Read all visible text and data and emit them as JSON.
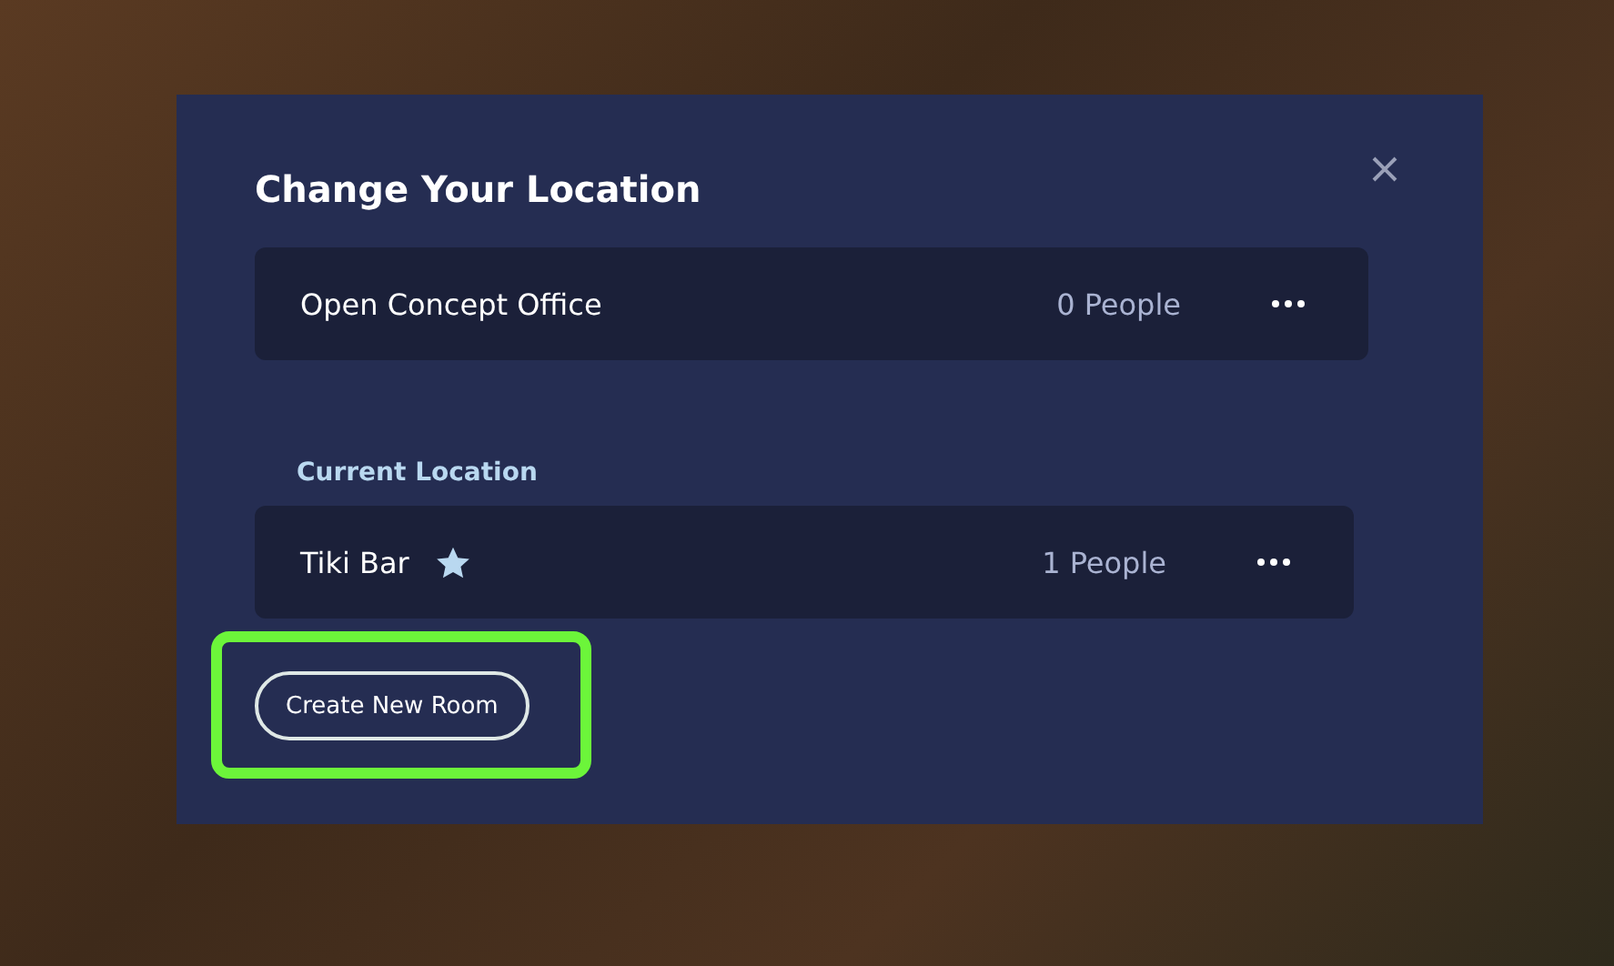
{
  "dialog": {
    "title": "Change Your Location",
    "rooms": [
      {
        "name": "Open Concept Office",
        "count": "0 People",
        "starred": false
      }
    ],
    "current_section": {
      "heading": "Current Location",
      "room": {
        "name": "Tiki Bar",
        "count": "1 People",
        "starred": true
      }
    },
    "create_button": {
      "label": "Create New Room",
      "highlighted": true
    }
  }
}
